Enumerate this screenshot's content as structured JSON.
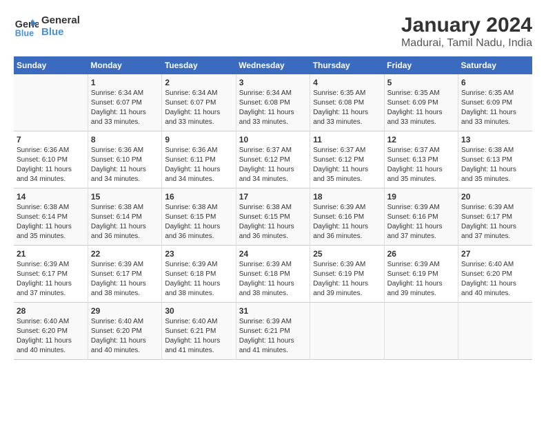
{
  "header": {
    "logo_line1": "General",
    "logo_line2": "Blue",
    "title": "January 2024",
    "subtitle": "Madurai, Tamil Nadu, India"
  },
  "calendar": {
    "weekdays": [
      "Sunday",
      "Monday",
      "Tuesday",
      "Wednesday",
      "Thursday",
      "Friday",
      "Saturday"
    ],
    "weeks": [
      [
        {
          "day": "",
          "info": ""
        },
        {
          "day": "1",
          "info": "Sunrise: 6:34 AM\nSunset: 6:07 PM\nDaylight: 11 hours\nand 33 minutes."
        },
        {
          "day": "2",
          "info": "Sunrise: 6:34 AM\nSunset: 6:07 PM\nDaylight: 11 hours\nand 33 minutes."
        },
        {
          "day": "3",
          "info": "Sunrise: 6:34 AM\nSunset: 6:08 PM\nDaylight: 11 hours\nand 33 minutes."
        },
        {
          "day": "4",
          "info": "Sunrise: 6:35 AM\nSunset: 6:08 PM\nDaylight: 11 hours\nand 33 minutes."
        },
        {
          "day": "5",
          "info": "Sunrise: 6:35 AM\nSunset: 6:09 PM\nDaylight: 11 hours\nand 33 minutes."
        },
        {
          "day": "6",
          "info": "Sunrise: 6:35 AM\nSunset: 6:09 PM\nDaylight: 11 hours\nand 33 minutes."
        }
      ],
      [
        {
          "day": "7",
          "info": "Sunrise: 6:36 AM\nSunset: 6:10 PM\nDaylight: 11 hours\nand 34 minutes."
        },
        {
          "day": "8",
          "info": "Sunrise: 6:36 AM\nSunset: 6:10 PM\nDaylight: 11 hours\nand 34 minutes."
        },
        {
          "day": "9",
          "info": "Sunrise: 6:36 AM\nSunset: 6:11 PM\nDaylight: 11 hours\nand 34 minutes."
        },
        {
          "day": "10",
          "info": "Sunrise: 6:37 AM\nSunset: 6:12 PM\nDaylight: 11 hours\nand 34 minutes."
        },
        {
          "day": "11",
          "info": "Sunrise: 6:37 AM\nSunset: 6:12 PM\nDaylight: 11 hours\nand 35 minutes."
        },
        {
          "day": "12",
          "info": "Sunrise: 6:37 AM\nSunset: 6:13 PM\nDaylight: 11 hours\nand 35 minutes."
        },
        {
          "day": "13",
          "info": "Sunrise: 6:38 AM\nSunset: 6:13 PM\nDaylight: 11 hours\nand 35 minutes."
        }
      ],
      [
        {
          "day": "14",
          "info": "Sunrise: 6:38 AM\nSunset: 6:14 PM\nDaylight: 11 hours\nand 35 minutes."
        },
        {
          "day": "15",
          "info": "Sunrise: 6:38 AM\nSunset: 6:14 PM\nDaylight: 11 hours\nand 36 minutes."
        },
        {
          "day": "16",
          "info": "Sunrise: 6:38 AM\nSunset: 6:15 PM\nDaylight: 11 hours\nand 36 minutes."
        },
        {
          "day": "17",
          "info": "Sunrise: 6:38 AM\nSunset: 6:15 PM\nDaylight: 11 hours\nand 36 minutes."
        },
        {
          "day": "18",
          "info": "Sunrise: 6:39 AM\nSunset: 6:16 PM\nDaylight: 11 hours\nand 36 minutes."
        },
        {
          "day": "19",
          "info": "Sunrise: 6:39 AM\nSunset: 6:16 PM\nDaylight: 11 hours\nand 37 minutes."
        },
        {
          "day": "20",
          "info": "Sunrise: 6:39 AM\nSunset: 6:17 PM\nDaylight: 11 hours\nand 37 minutes."
        }
      ],
      [
        {
          "day": "21",
          "info": "Sunrise: 6:39 AM\nSunset: 6:17 PM\nDaylight: 11 hours\nand 37 minutes."
        },
        {
          "day": "22",
          "info": "Sunrise: 6:39 AM\nSunset: 6:17 PM\nDaylight: 11 hours\nand 38 minutes."
        },
        {
          "day": "23",
          "info": "Sunrise: 6:39 AM\nSunset: 6:18 PM\nDaylight: 11 hours\nand 38 minutes."
        },
        {
          "day": "24",
          "info": "Sunrise: 6:39 AM\nSunset: 6:18 PM\nDaylight: 11 hours\nand 38 minutes."
        },
        {
          "day": "25",
          "info": "Sunrise: 6:39 AM\nSunset: 6:19 PM\nDaylight: 11 hours\nand 39 minutes."
        },
        {
          "day": "26",
          "info": "Sunrise: 6:39 AM\nSunset: 6:19 PM\nDaylight: 11 hours\nand 39 minutes."
        },
        {
          "day": "27",
          "info": "Sunrise: 6:40 AM\nSunset: 6:20 PM\nDaylight: 11 hours\nand 40 minutes."
        }
      ],
      [
        {
          "day": "28",
          "info": "Sunrise: 6:40 AM\nSunset: 6:20 PM\nDaylight: 11 hours\nand 40 minutes."
        },
        {
          "day": "29",
          "info": "Sunrise: 6:40 AM\nSunset: 6:20 PM\nDaylight: 11 hours\nand 40 minutes."
        },
        {
          "day": "30",
          "info": "Sunrise: 6:40 AM\nSunset: 6:21 PM\nDaylight: 11 hours\nand 41 minutes."
        },
        {
          "day": "31",
          "info": "Sunrise: 6:39 AM\nSunset: 6:21 PM\nDaylight: 11 hours\nand 41 minutes."
        },
        {
          "day": "",
          "info": ""
        },
        {
          "day": "",
          "info": ""
        },
        {
          "day": "",
          "info": ""
        }
      ]
    ]
  }
}
